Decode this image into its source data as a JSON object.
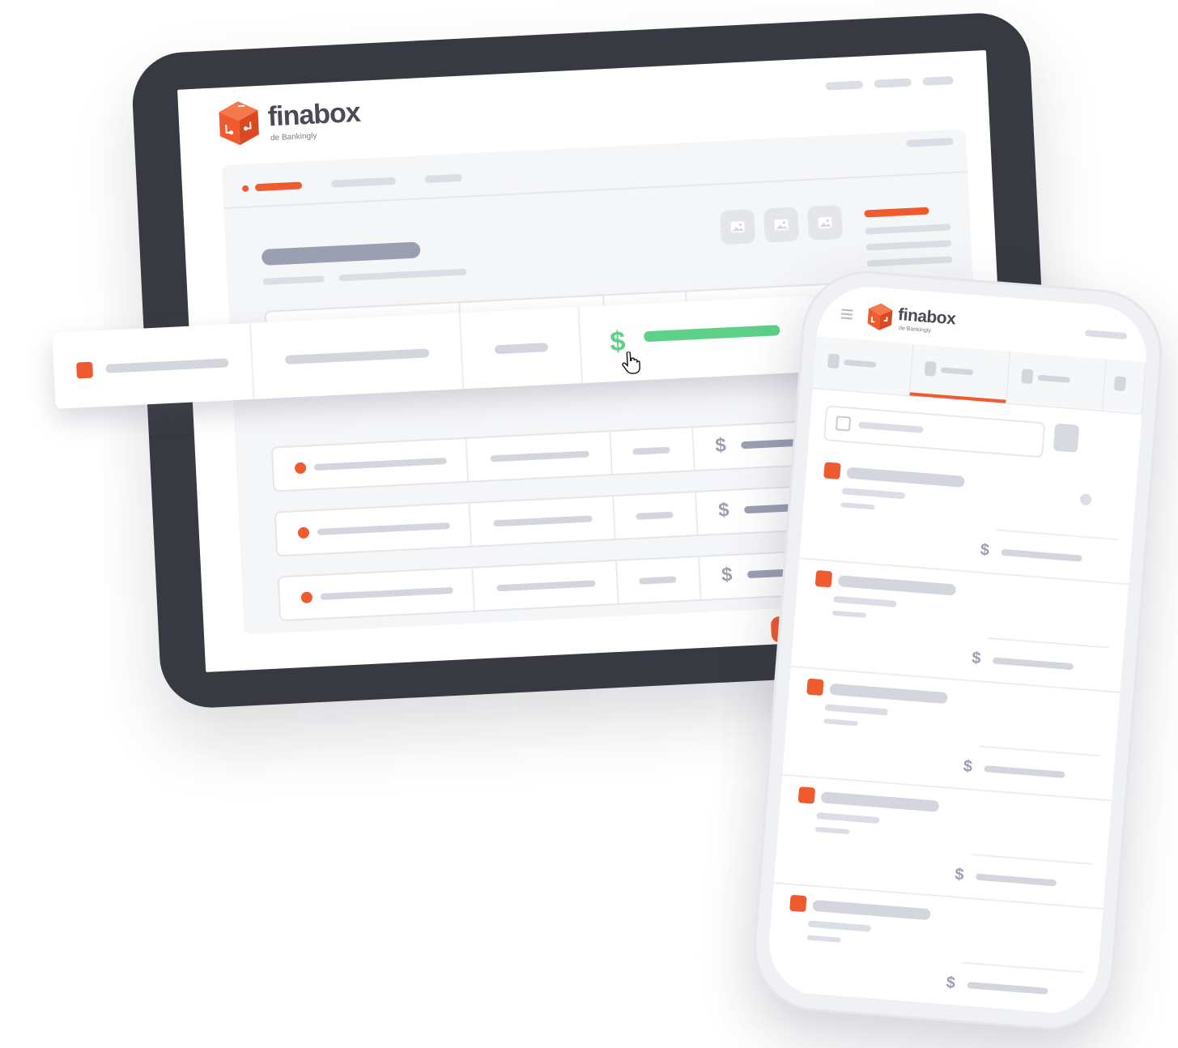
{
  "brand": {
    "name": "finabox",
    "tagline": "de Bankingly",
    "accent_color": "#f05a2f",
    "success_color": "#5cd187"
  },
  "tablet": {
    "currency_symbol": "$",
    "rows": 4,
    "header_images": [
      "image-icon",
      "image-icon",
      "image-icon"
    ]
  },
  "highlight_row": {
    "currency_symbol": "$",
    "cursor": "hand-pointer-icon"
  },
  "phone": {
    "brand_name": "finabox",
    "brand_tagline": "de Bankingly",
    "currency_symbol": "$",
    "items": 5
  }
}
